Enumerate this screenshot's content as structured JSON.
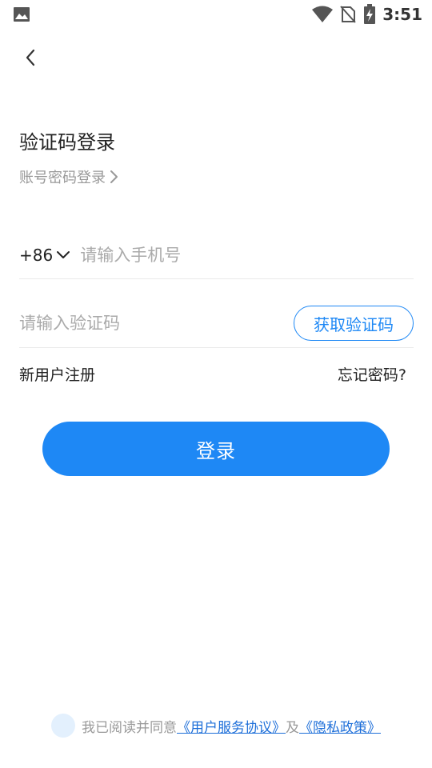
{
  "status_bar": {
    "time": "3:51",
    "icons": [
      "gallery-icon",
      "wifi-icon",
      "no-sim-icon",
      "battery-charging-icon"
    ]
  },
  "nav": {
    "back_icon": "chevron-left-icon"
  },
  "login": {
    "title": "验证码登录",
    "switch_label": "账号密码登录",
    "switch_icon": "chevron-right-icon",
    "country_code": "+86",
    "phone_placeholder": "请输入手机号",
    "phone_value": "",
    "code_placeholder": "请输入验证码",
    "code_value": "",
    "get_code_label": "获取验证码",
    "register_label": "新用户注册",
    "forgot_label": "忘记密码?",
    "submit_label": "登录"
  },
  "agreement": {
    "prefix": "我已阅读并同意",
    "terms_link": "《用户服务协议》",
    "and": "及",
    "privacy_link": "《隐私政策》",
    "checked": false
  },
  "colors": {
    "accent": "#1e88f5",
    "link": "#1e6fd9",
    "placeholder": "#aaaaaa",
    "muted": "#999999",
    "divider": "#eaeaea"
  }
}
